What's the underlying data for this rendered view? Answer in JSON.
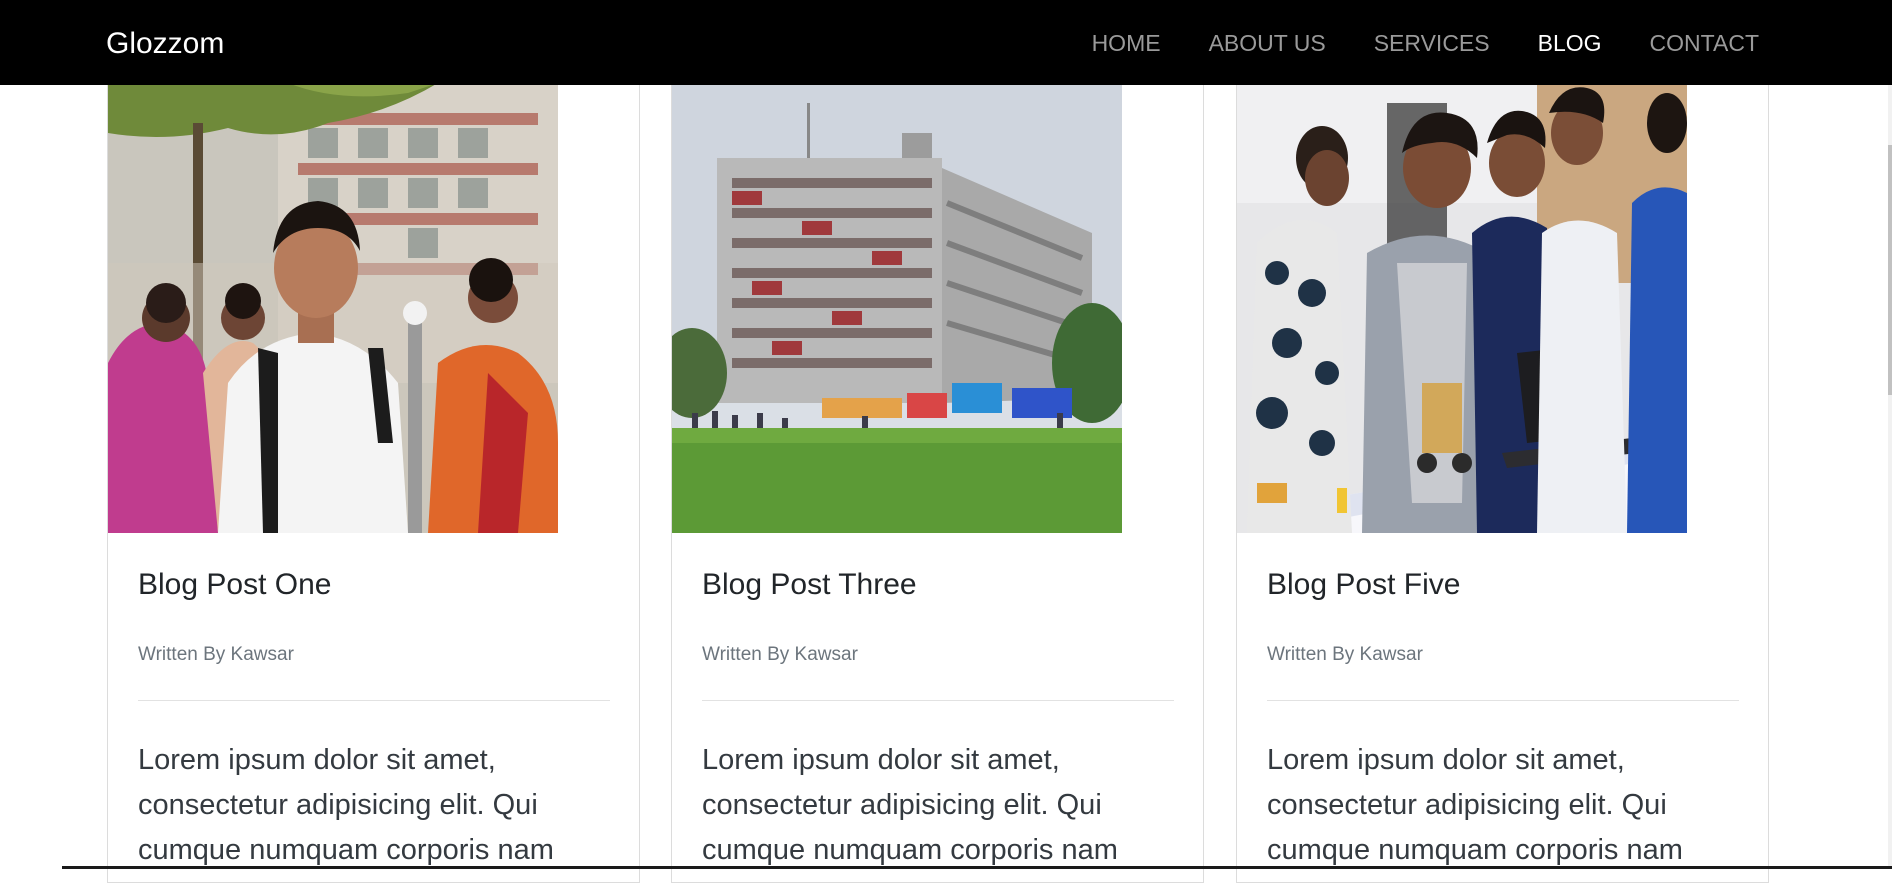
{
  "navbar": {
    "brand": "Glozzom",
    "links": [
      {
        "label": "HOME",
        "active": false
      },
      {
        "label": "ABOUT US",
        "active": false
      },
      {
        "label": "SERVICES",
        "active": false
      },
      {
        "label": "BLOG",
        "active": true
      },
      {
        "label": "CONTACT",
        "active": false
      }
    ]
  },
  "cards": [
    {
      "image": "student-with-backpack-photo",
      "title": "Blog Post One",
      "author": "Written By Kawsar",
      "body": "Lorem ipsum dolor sit amet, consectetur adipisicing elit. Qui cumque numquam corporis nam"
    },
    {
      "image": "campus-building-photo",
      "title": "Blog Post Three",
      "author": "Written By Kawsar",
      "body": "Lorem ipsum dolor sit amet, consectetur adipisicing elit. Qui cumque numquam corporis nam"
    },
    {
      "image": "students-robotics-lab-photo",
      "title": "Blog Post Five",
      "author": "Written By Kawsar",
      "body": "Lorem ipsum dolor sit amet, consectetur adipisicing elit. Qui cumque numquam corporis nam"
    }
  ],
  "colors": {
    "navbar_bg": "#000000",
    "nav_inactive": "#9a9a9a",
    "nav_active": "#ffffff",
    "author_text": "#6c757d"
  }
}
